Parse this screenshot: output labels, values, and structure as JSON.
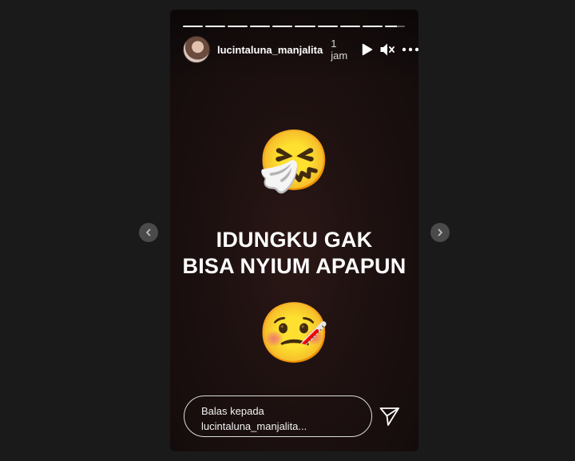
{
  "story": {
    "username": "lucintaluna_manjalita",
    "time": "1 jam",
    "segments_total": 10,
    "current_segment": 10,
    "emoji_top": "🤧",
    "emoji_bottom": "🤒",
    "headline_line1": "IDUNGKU GAK",
    "headline_line2": "BISA NYIUM APAPUN"
  },
  "header": {
    "icons": [
      "play-icon",
      "mute-icon",
      "more-icon"
    ]
  },
  "reply": {
    "line1": "Balas kepada",
    "line2": "lucintaluna_manjalita..."
  },
  "navigation": {
    "icons": [
      "chevron-left-icon",
      "chevron-right-icon"
    ]
  }
}
